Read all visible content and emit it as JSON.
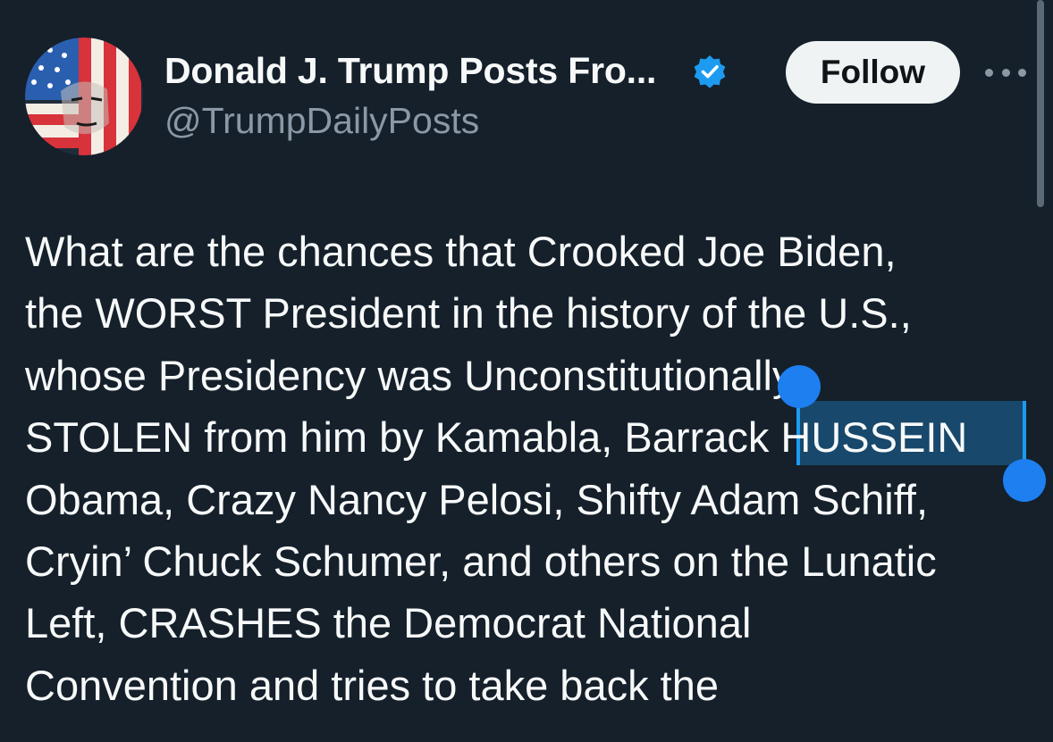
{
  "author": {
    "display_name": "Donald J. Trump Posts Fro...",
    "handle": "@TrumpDailyPosts",
    "verified_icon": "verified-badge-icon"
  },
  "actions": {
    "follow_label": "Follow",
    "more_icon": "more-horizontal-icon"
  },
  "post": {
    "lines": [
      "What are the chances that Crooked Joe Biden,",
      "the WORST President in the history of the U.S.,",
      "whose Presidency was Unconstitutionally",
      "STOLEN from him by Kamabla, Barrack HUSSEIN",
      "Obama, Crazy Nancy Pelosi, Shifty Adam Schiff,",
      "Cryin’ Chuck Schumer, and others on the Lunatic",
      "Left, CRASHES the Democrat National",
      "Convention and tries to take back the"
    ],
    "selected_text": "k HUSSEIN"
  },
  "colors": {
    "background": "#15202b",
    "text": "#f7f9f9",
    "muted": "#8b98a5",
    "accent": "#1d9bf0"
  }
}
